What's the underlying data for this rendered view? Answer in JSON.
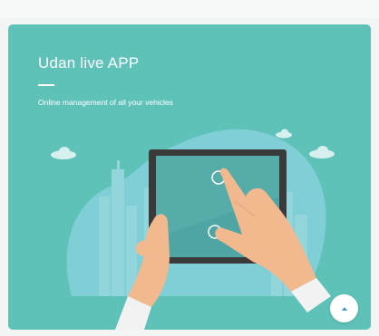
{
  "card": {
    "title": "Udan live APP",
    "subtitle": "Online management of all your vehicles"
  },
  "illustration": {
    "name": "hands-using-tablet-illustration",
    "tablet_frame_color": "#3a3a3a",
    "tablet_screen_color": "#4fa5a3",
    "hand_color": "#f2b98f",
    "blob_color": "#80cfd6"
  },
  "scroll_top_button": {
    "icon": "arrow-up-icon",
    "icon_color": "#3e98d0"
  },
  "colors": {
    "card_background": "#5ec2b9",
    "page_background": "#f3f4f4"
  }
}
